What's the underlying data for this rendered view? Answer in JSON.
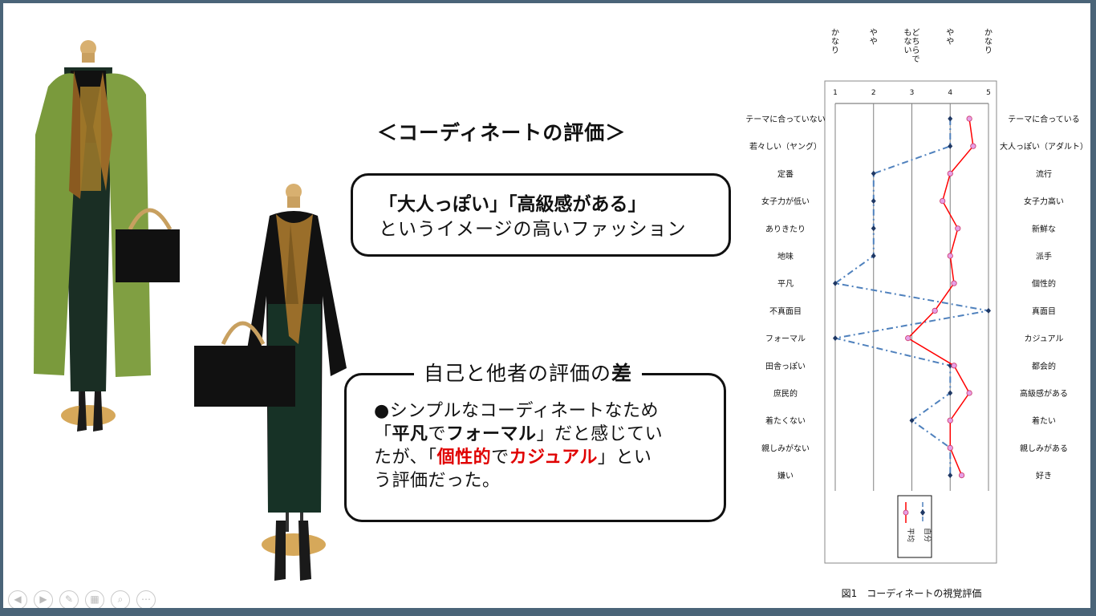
{
  "slide": {
    "heading": "＜コーディネートの評価＞",
    "box1": {
      "line1": "「大人っぽい」「高級感がある」",
      "line2": "というイメージの高いファッション"
    },
    "box2": {
      "title_pre": "自己と他者の評価の",
      "title_bold": "差",
      "t1": "●シンプルなコーディネートなため",
      "t2": "「",
      "t3": "平凡",
      "t4": "で",
      "t5": "フォーマル",
      "t6": "」だと感じてい",
      "t7": "たが、「",
      "t8": "個性的",
      "t9": "で",
      "t10": "カジュアル",
      "t11": "」とい",
      "t12": "う評価だった。"
    }
  },
  "chart_data": {
    "type": "line",
    "caption": "図1　コーディネートの視覚評価",
    "scale_headers": [
      "かなり",
      "やや",
      "どちらでもない",
      "やや",
      "かなり"
    ],
    "ticks": [
      "1",
      "2",
      "3",
      "4",
      "5"
    ],
    "xlim": [
      1,
      5
    ],
    "left_labels": [
      "テーマに合っていない",
      "若々しい（ヤング）",
      "定番",
      "女子力が低い",
      "ありきたり",
      "地味",
      "平凡",
      "不真面目",
      "フォーマル",
      "田舎っぽい",
      "庶民的",
      "着たくない",
      "親しみがない",
      "嫌い"
    ],
    "right_labels": [
      "テーマに合っている",
      "大人っぽい（アダルト）",
      "流行",
      "女子力高い",
      "新鮮な",
      "派手",
      "個性的",
      "真面目",
      "カジュアル",
      "都会的",
      "高級感がある",
      "着たい",
      "親しみがある",
      "好き"
    ],
    "series": [
      {
        "name": "自分",
        "color": "#4f81bd",
        "values": [
          4,
          4,
          2,
          2,
          2,
          2,
          1,
          5,
          1,
          4,
          4,
          3,
          4,
          4
        ]
      },
      {
        "name": "平均",
        "color": "#ff0000",
        "values": [
          4.5,
          4.6,
          4.0,
          3.8,
          4.2,
          4.0,
          4.1,
          3.6,
          2.9,
          4.1,
          4.5,
          4.0,
          4.0,
          4.3
        ]
      }
    ],
    "grid": true,
    "legend_position": "bottom"
  },
  "toolbar": {
    "icons": [
      "prev-icon",
      "next-icon",
      "pen-icon",
      "slides-icon",
      "zoom-icon",
      "more-icon"
    ],
    "glyphs": [
      "◀",
      "▶",
      "✎",
      "▦",
      "⌕",
      "⋯"
    ]
  }
}
